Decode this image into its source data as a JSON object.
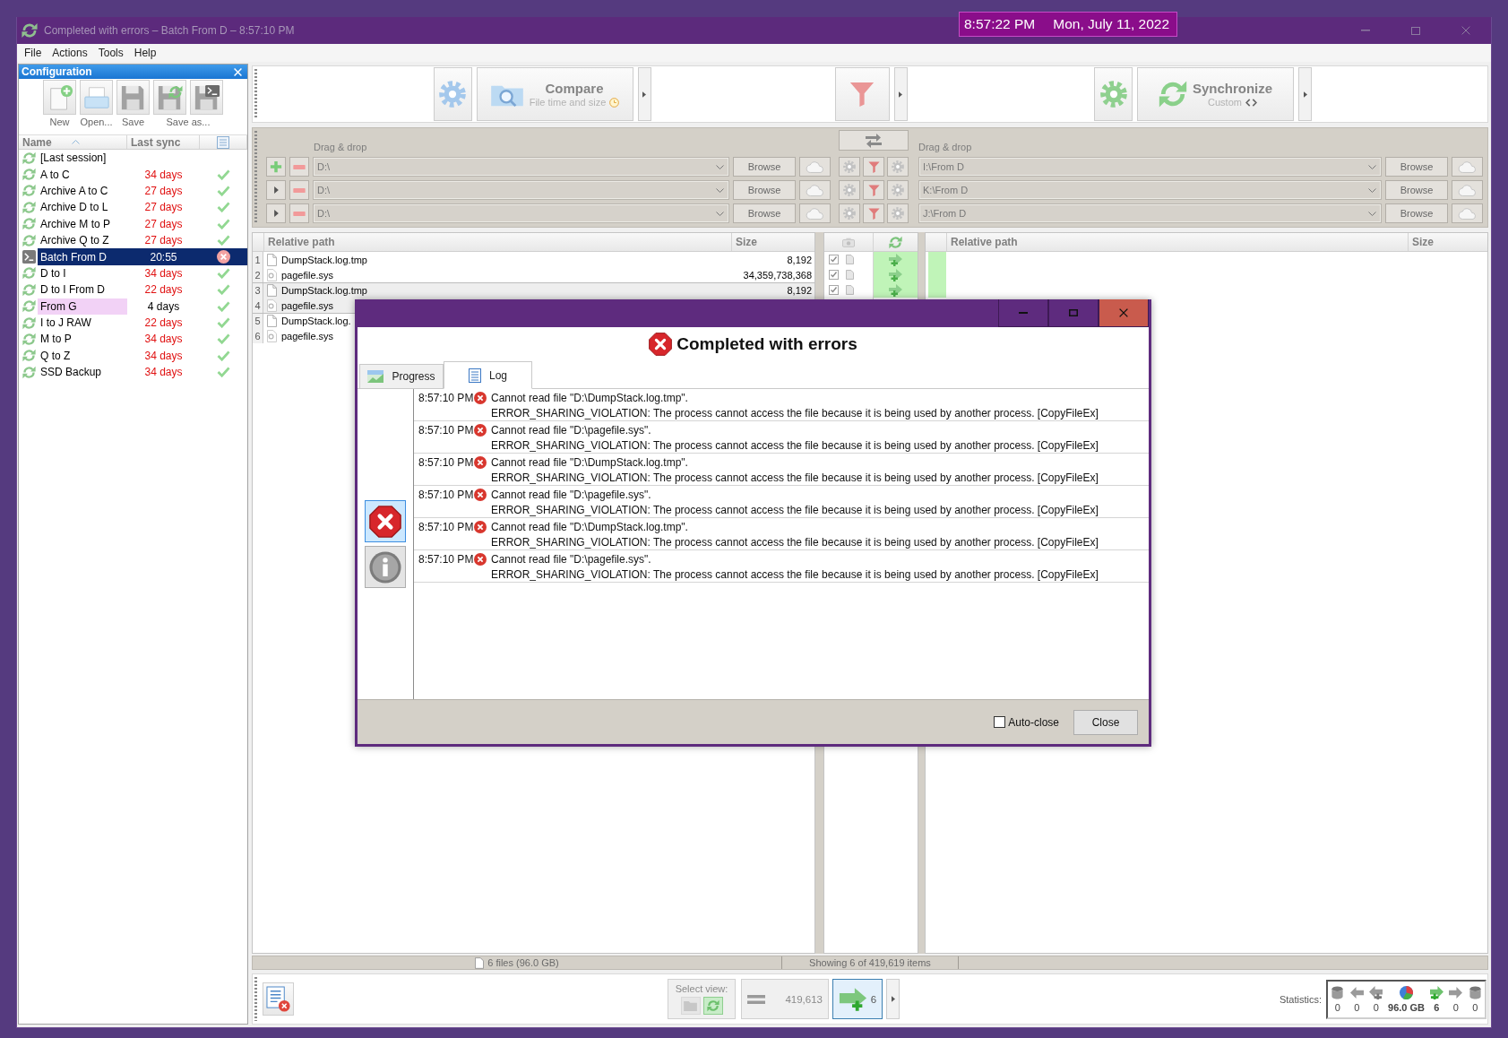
{
  "desktop_clock": {
    "time": "8:57:22 PM",
    "date": "Mon, July 11, 2022"
  },
  "window": {
    "title": "Completed with errors – Batch From D – 8:57:10 PM"
  },
  "menu": [
    "File",
    "Actions",
    "Tools",
    "Help"
  ],
  "config_panel": {
    "title": "Configuration",
    "toolbar": [
      {
        "label": "New",
        "buttons": [
          {
            "kind": "new"
          }
        ]
      },
      {
        "label": "Open...",
        "buttons": [
          {
            "kind": "open"
          }
        ]
      },
      {
        "label": "Save",
        "buttons": [
          {
            "kind": "save"
          }
        ]
      },
      {
        "label": "Save as...",
        "buttons": [
          {
            "kind": "save_as"
          },
          {
            "kind": "save_as_batch"
          }
        ]
      }
    ],
    "columns": [
      "Name",
      "Last sync"
    ],
    "items": [
      {
        "name": "[Last session]",
        "kind": "sync",
        "selected": false
      },
      {
        "name": "A to C",
        "kind": "sync",
        "last_sync": "34 days",
        "overdue": true,
        "status": {
          "kind": "ok"
        },
        "selected": false
      },
      {
        "name": "Archive A to C",
        "kind": "sync",
        "last_sync": "27 days",
        "overdue": true,
        "status": {
          "kind": "ok"
        },
        "selected": false
      },
      {
        "name": "Archive D to L",
        "kind": "sync",
        "last_sync": "27 days",
        "overdue": true,
        "status": {
          "kind": "ok"
        },
        "selected": false
      },
      {
        "name": "Archive M to P",
        "kind": "sync",
        "last_sync": "27 days",
        "overdue": true,
        "status": {
          "kind": "ok"
        },
        "selected": false
      },
      {
        "name": "Archive Q to Z",
        "kind": "sync",
        "last_sync": "27 days",
        "overdue": true,
        "status": {
          "kind": "ok"
        },
        "selected": false
      },
      {
        "name": "Batch From D",
        "kind": "batch",
        "last_sync": "20:55",
        "overdue": false,
        "status": {
          "kind": "error"
        },
        "selected": true
      },
      {
        "name": "D to I",
        "kind": "sync",
        "last_sync": "34 days",
        "overdue": true,
        "status": {
          "kind": "ok"
        },
        "selected": false
      },
      {
        "name": "D to I From D",
        "kind": "sync",
        "last_sync": "22 days",
        "overdue": true,
        "status": {
          "kind": "ok"
        },
        "selected": false
      },
      {
        "name": "From G",
        "kind": "sync",
        "last_sync": "4 days",
        "overdue": false,
        "status": {
          "kind": "ok"
        },
        "selected": false,
        "color": "#f2d2f6"
      },
      {
        "name": "I to J RAW",
        "kind": "sync",
        "last_sync": "22 days",
        "overdue": true,
        "status": {
          "kind": "ok"
        },
        "selected": false
      },
      {
        "name": "M to P",
        "kind": "sync",
        "last_sync": "34 days",
        "overdue": true,
        "status": {
          "kind": "ok"
        },
        "selected": false
      },
      {
        "name": "Q to Z",
        "kind": "sync",
        "last_sync": "34 days",
        "overdue": true,
        "status": {
          "kind": "ok"
        },
        "selected": false
      },
      {
        "name": "SSD Backup",
        "kind": "sync",
        "last_sync": "34 days",
        "overdue": true,
        "status": {
          "kind": "ok"
        },
        "selected": false
      }
    ]
  },
  "toolbar": {
    "compare": {
      "title": "Compare",
      "subtitle": "File time and size"
    },
    "synchronize": {
      "title": "Synchronize",
      "subtitle": "Custom"
    }
  },
  "folder_pairs": {
    "left_label": "Drag & drop",
    "right_label": "Drag & drop",
    "rows": [
      {
        "kind": "main",
        "left_path": "D:\\",
        "left_browse": "Browse",
        "right_path": "I:\\From D",
        "right_browse": "Browse"
      },
      {
        "kind": "additional",
        "left_path": "D:\\",
        "left_browse": "Browse",
        "right_path": "K:\\From D",
        "right_browse": "Browse"
      },
      {
        "kind": "additional",
        "left_path": "D:\\",
        "left_browse": "Browse",
        "right_path": "J:\\From D",
        "right_browse": "Browse"
      }
    ]
  },
  "grid": {
    "left_columns": [
      "Relative path",
      "Size"
    ],
    "right_columns": [
      "Relative path",
      "Size"
    ],
    "rows": [
      {
        "number": "1",
        "name": "DumpStack.log.tmp",
        "kind": "file",
        "size": "8,192",
        "checked": true,
        "action": {
          "kind": "create"
        },
        "shaded": false
      },
      {
        "number": "2",
        "name": "pagefile.sys",
        "kind": "system",
        "size": "34,359,738,368",
        "checked": true,
        "action": {
          "kind": "create"
        },
        "shaded": false
      },
      {
        "number": "3",
        "name": "DumpStack.log.tmp",
        "kind": "file",
        "size": "8,192",
        "checked": true,
        "action": {
          "kind": "create"
        },
        "shaded": true
      },
      {
        "number": "4",
        "name": "pagefile.sys",
        "kind": "system",
        "shaded": true
      },
      {
        "number": "5",
        "name": "DumpStack.log.",
        "kind": "file",
        "shaded": false
      },
      {
        "number": "6",
        "name": "pagefile.sys",
        "kind": "system",
        "shaded": false
      }
    ]
  },
  "status_bar": {
    "left": "6 files (96.0 GB)",
    "center": "Showing 6 of 419,619 items"
  },
  "bottom_bar": {
    "select_view": {
      "label": "Select view:",
      "options": [
        {
          "kind": "compare",
          "selected": false
        },
        {
          "kind": "sync",
          "selected": true
        }
      ]
    },
    "view_filters": [
      {
        "kind": "equal",
        "count": "419,613",
        "on": false
      },
      {
        "kind": "create_right",
        "count": "6",
        "on": true
      }
    ],
    "statistics": {
      "label": "Statistics:",
      "items": [
        {
          "kind": "delete_left",
          "value": "0",
          "active": false
        },
        {
          "kind": "update_left",
          "value": "0",
          "active": false
        },
        {
          "kind": "create_left",
          "value": "0",
          "active": false
        },
        {
          "kind": "data",
          "value": "96.0 GB",
          "active": true
        },
        {
          "kind": "create_right",
          "value": "6",
          "active": true
        },
        {
          "kind": "update_right",
          "value": "0",
          "active": false
        },
        {
          "kind": "delete_right",
          "value": "0",
          "active": false
        }
      ]
    }
  },
  "dialog": {
    "heading": "Completed with errors",
    "tabs": [
      {
        "label": "Progress",
        "kind": "progress",
        "selected": false
      },
      {
        "label": "Log",
        "kind": "log",
        "selected": true
      }
    ],
    "log_filters": [
      {
        "kind": "error",
        "selected": true
      },
      {
        "kind": "info",
        "selected": false
      }
    ],
    "log": [
      {
        "kind": "error",
        "time": "8:57:10 PM",
        "message": "Cannot read file \"D:\\DumpStack.log.tmp\".",
        "detail": "ERROR_SHARING_VIOLATION: The process cannot access the file because it is being used by another process. [CopyFileEx]"
      },
      {
        "kind": "error",
        "time": "8:57:10 PM",
        "message": "Cannot read file \"D:\\pagefile.sys\".",
        "detail": "ERROR_SHARING_VIOLATION: The process cannot access the file because it is being used by another process. [CopyFileEx]"
      },
      {
        "kind": "error",
        "time": "8:57:10 PM",
        "message": "Cannot read file \"D:\\DumpStack.log.tmp\".",
        "detail": "ERROR_SHARING_VIOLATION: The process cannot access the file because it is being used by another process. [CopyFileEx]"
      },
      {
        "kind": "error",
        "time": "8:57:10 PM",
        "message": "Cannot read file \"D:\\pagefile.sys\".",
        "detail": "ERROR_SHARING_VIOLATION: The process cannot access the file because it is being used by another process. [CopyFileEx]"
      },
      {
        "kind": "error",
        "time": "8:57:10 PM",
        "message": "Cannot read file \"D:\\DumpStack.log.tmp\".",
        "detail": "ERROR_SHARING_VIOLATION: The process cannot access the file because it is being used by another process. [CopyFileEx]"
      },
      {
        "kind": "error",
        "time": "8:57:10 PM",
        "message": "Cannot read file \"D:\\pagefile.sys\".",
        "detail": "ERROR_SHARING_VIOLATION: The process cannot access the file because it is being used by another process. [CopyFileEx]"
      }
    ],
    "auto_close": {
      "label": "Auto-close",
      "checked": false
    },
    "close_button": "Close"
  }
}
